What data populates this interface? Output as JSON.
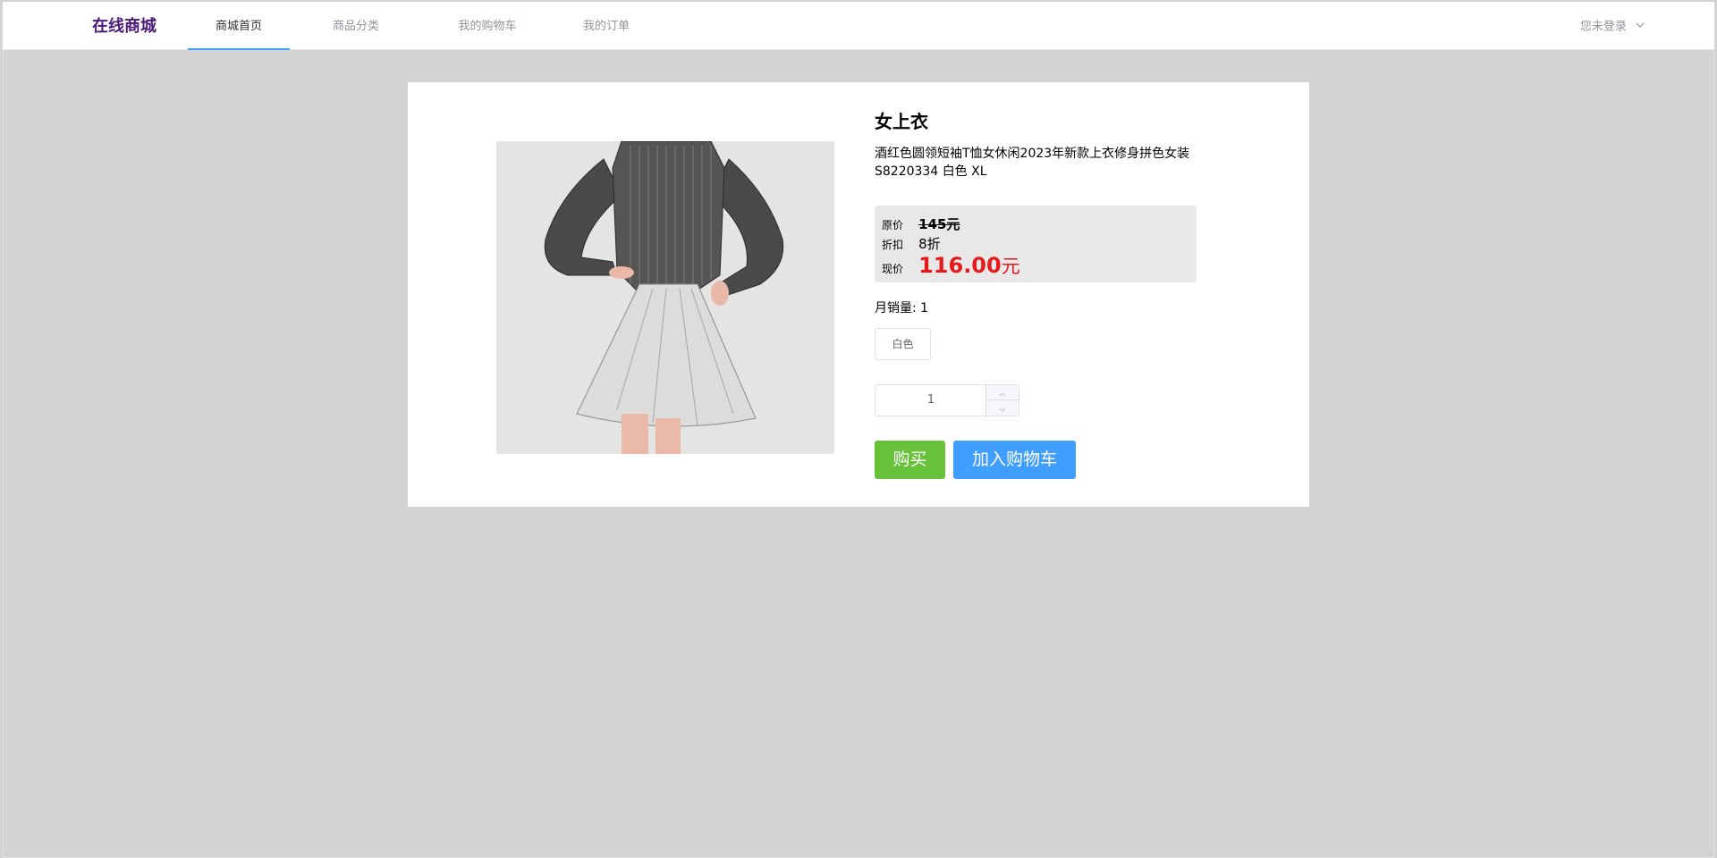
{
  "header": {
    "brand": "在线商城",
    "menu": [
      {
        "label": "商城首页",
        "active": true
      },
      {
        "label": "商品分类",
        "active": false
      },
      {
        "label": "我的购物车",
        "active": false
      },
      {
        "label": "我的订单",
        "active": false
      }
    ],
    "user_label": "您未登录",
    "user_icon": "chevron-down-icon"
  },
  "product": {
    "title": "女上衣",
    "description": "酒红色圆领短袖T恤女休闲2023年新款上衣修身拼色女装S8220334 白色 XL",
    "image_icon": "product-photo-woman-shirt-skirt",
    "price": {
      "original_label": "原价",
      "original_value": "145元",
      "discount_label": "折扣",
      "discount_value": "8折",
      "current_label": "现价",
      "current_value": "116.00",
      "current_unit": "元"
    },
    "sales_label": "月销量:",
    "sales_value": "1",
    "color_option": "白色",
    "quantity": "1",
    "buy_label": "购买",
    "cart_label": "加入购物车"
  },
  "colors": {
    "brand": "#4b1a7a",
    "buy": "#67c23a",
    "cart": "#409eff",
    "price": "#e61a1a",
    "background": "#d3d3d3"
  }
}
